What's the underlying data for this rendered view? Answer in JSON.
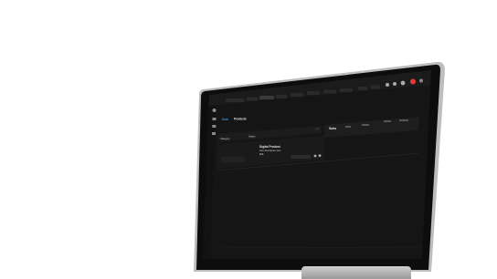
{
  "toolbar": {
    "items": [
      "Home",
      "Create",
      "Dashboard",
      "Products",
      "Orders",
      "Customers",
      "Reports"
    ]
  },
  "breadcrumb": {
    "back_label": "Back",
    "title": "Products"
  },
  "filters": {
    "category_label": "Category",
    "status_label": "Status",
    "side_title": "Sales"
  },
  "product": {
    "name": "Digital Product",
    "desc": "Item description text",
    "price": "$99"
  },
  "colors": {
    "bezel": "#0d0d0d",
    "screen_bg": "#151515",
    "topbar": "#1c1c1c",
    "accent": "#2f8bff",
    "badge": "#e53935"
  }
}
